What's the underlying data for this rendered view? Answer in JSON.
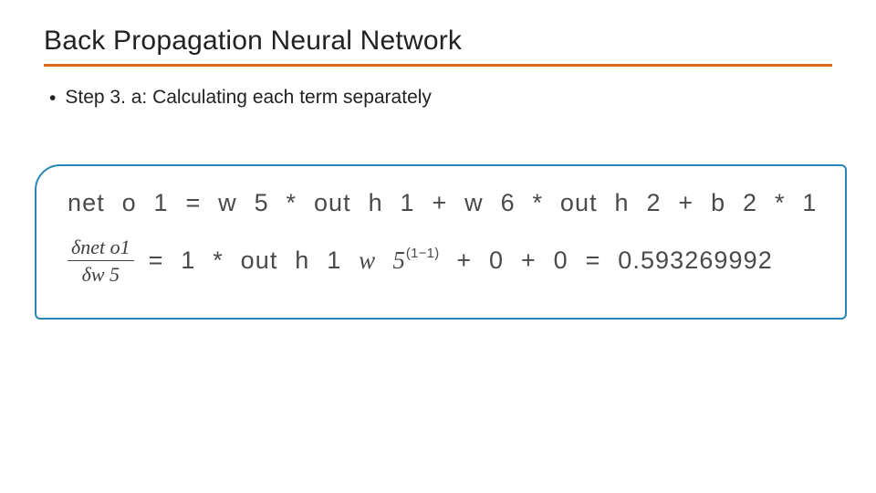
{
  "title": "Back Propagation Neural Network",
  "bullet": "Step 3. a: Calculating each term separately",
  "equation": {
    "line1": "net o 1 = w 5 * out h 1 + w 6 * out h 2 + b 2 * 1",
    "frac_num": "δnet o1",
    "frac_den": "δw 5",
    "rest_prefix": "= 1 * out h 1 ",
    "w_var": "w 5",
    "exp": "(1−1)",
    "rest_suffix": " + 0 + 0 = 0.593269992"
  }
}
